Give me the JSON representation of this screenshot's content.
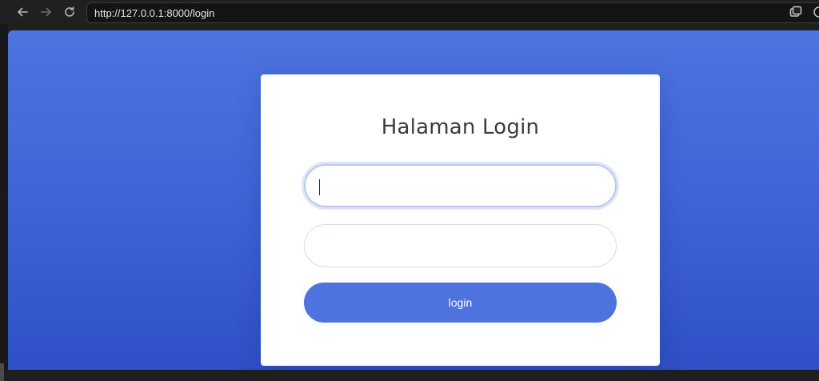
{
  "browser": {
    "url": "http://127.0.0.1:8000/login",
    "back_icon": "arrow-left-icon",
    "forward_icon": "arrow-right-icon",
    "reload_icon": "reload-icon"
  },
  "login": {
    "title": "Halaman Login",
    "username_value": "",
    "password_value": "",
    "button_label": "login"
  },
  "colors": {
    "background_top": "#4e74df",
    "background_bottom": "#2f50c6",
    "button": "#4e73df",
    "card": "#ffffff"
  }
}
